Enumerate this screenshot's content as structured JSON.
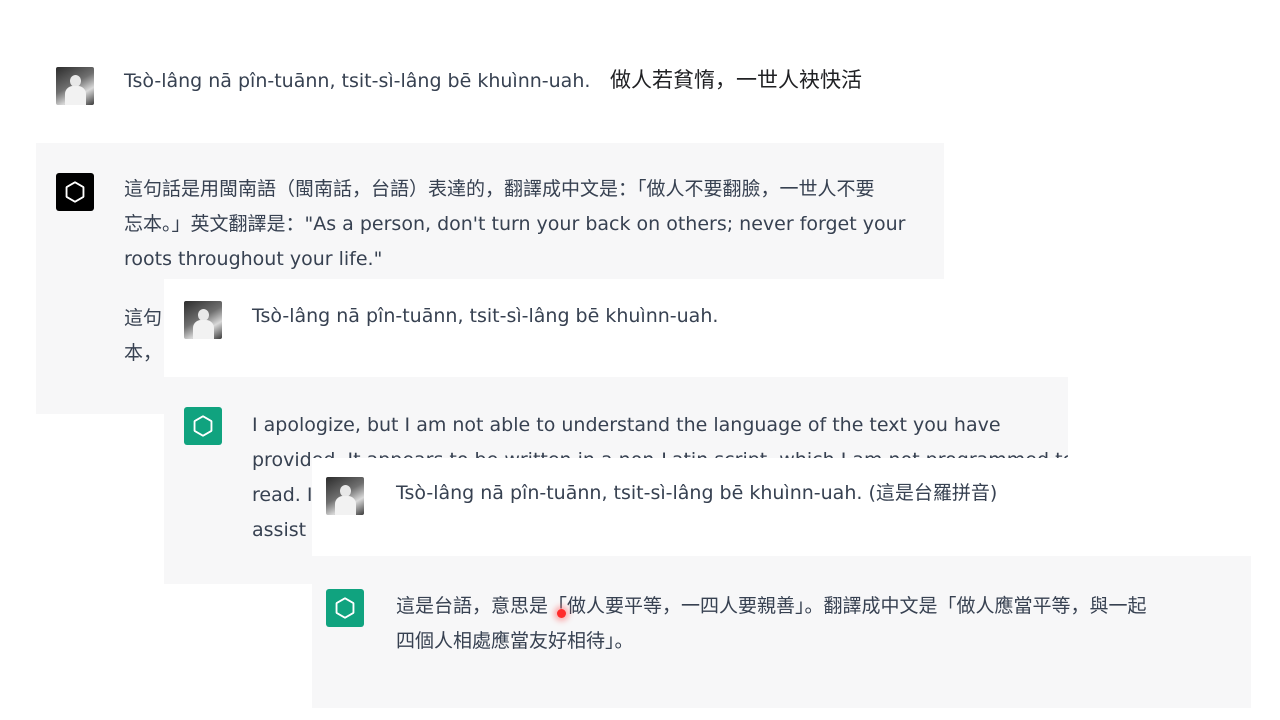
{
  "colors": {
    "assistant_bg": "#f7f7f8",
    "user_bg": "#ffffff",
    "text": "#374151",
    "logo_black": "#000000",
    "logo_green": "#10a37f",
    "cursor": "#ff2a2a"
  },
  "icons": {
    "user_avatar": "user-photo-avatar",
    "assistant_avatar": "openai-logo-icon"
  },
  "panel1": {
    "user_message": "Tsò-lâng nā pîn-tuānn, tsit-sì-lâng bē khuìnn-uah.",
    "annotation": "做人若貧惰，一世人袂快活",
    "assistant_lines": [
      "這句話是用閩南語（閩南話，台語）表達的，翻譯成中文是：「做人不要翻臉，一世人不要",
      "忘本。」英文翻譯是：\"As a person, don't turn your back on others; never forget your",
      "roots throughout your life.\""
    ],
    "assistant_lines_2": [
      "這句",
      "本，"
    ]
  },
  "panel2": {
    "user_message": "Tsò-lâng nā pîn-tuānn, tsit-sì-lâng bē khuìnn-uah.",
    "assistant_lines": [
      "I apologize, but I am not able to understand the language of the text you have",
      "provided. It appears to be written in a non-Latin script, which I am not programmed to",
      "read. It",
      "assist y"
    ]
  },
  "panel3": {
    "user_message": "Tsò-lâng nā pîn-tuānn, tsit-sì-lâng bē khuìnn-uah. (這是台羅拼音)",
    "assistant_lines": [
      "這是台語，意思是「做人要平等，一四人要親善」。翻譯成中文是「做人應當平等，與一起",
      "四個人相處應當友好相待」。"
    ]
  }
}
